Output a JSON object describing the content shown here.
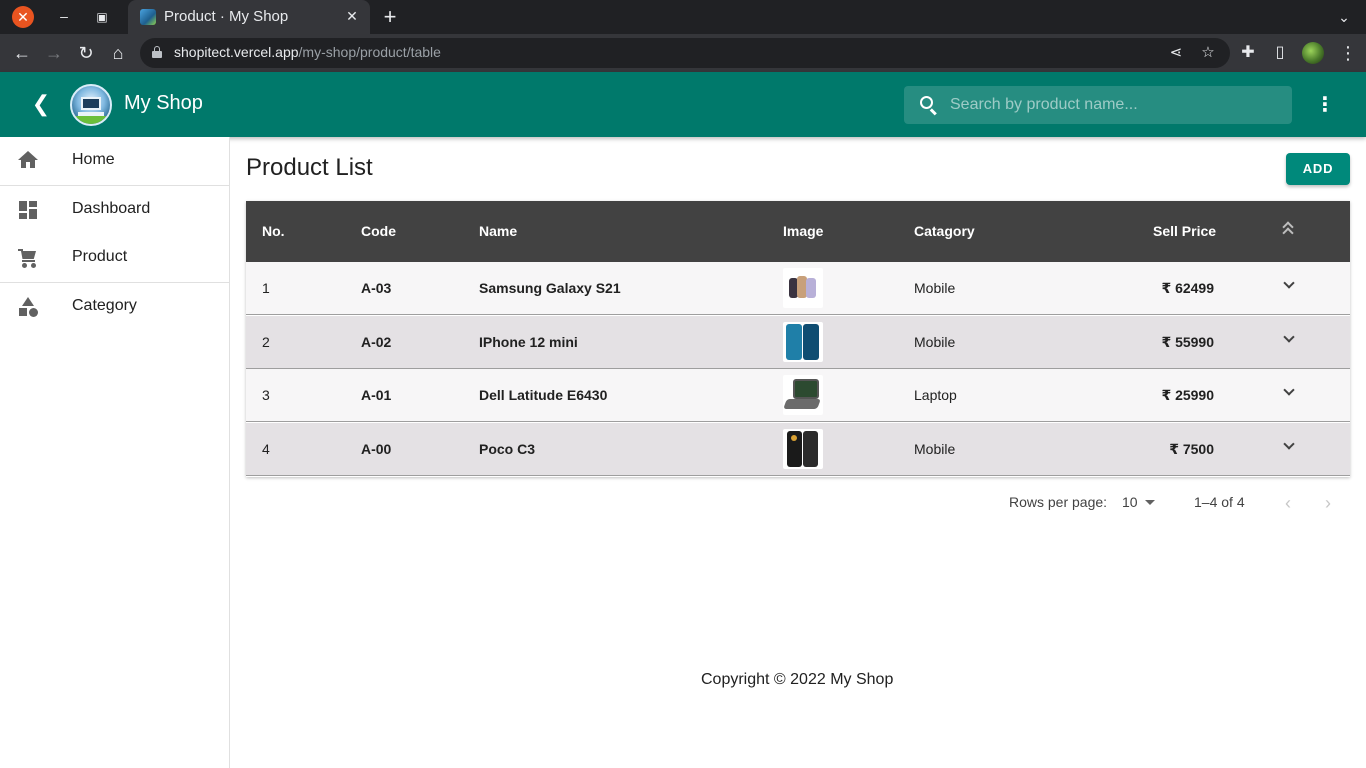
{
  "browser": {
    "tab_title": "Product · My Shop",
    "url_host": "shopitect.vercel.app",
    "url_path": "/my-shop/product/table"
  },
  "appbar": {
    "title": "My Shop",
    "search_placeholder": "Search by product name..."
  },
  "sidebar": {
    "items": [
      {
        "label": "Home",
        "icon": "home-icon"
      },
      {
        "label": "Dashboard",
        "icon": "dashboard-icon"
      },
      {
        "label": "Product",
        "icon": "cart-icon"
      },
      {
        "label": "Category",
        "icon": "category-icon"
      }
    ]
  },
  "main": {
    "title": "Product List",
    "add_label": "ADD"
  },
  "table": {
    "columns": [
      "No.",
      "Code",
      "Name",
      "Image",
      "Catagory",
      "Sell Price"
    ],
    "rows": [
      {
        "no": "1",
        "code": "A-03",
        "name": "Samsung Galaxy S21",
        "category": "Mobile",
        "price": "₹ 62499"
      },
      {
        "no": "2",
        "code": "A-02",
        "name": "IPhone 12 mini",
        "category": "Mobile",
        "price": "₹ 55990"
      },
      {
        "no": "3",
        "code": "A-01",
        "name": "Dell Latitude E6430",
        "category": "Laptop",
        "price": "₹ 25990"
      },
      {
        "no": "4",
        "code": "A-00",
        "name": "Poco C3",
        "category": "Mobile",
        "price": "₹ 7500"
      }
    ]
  },
  "pagination": {
    "rows_label": "Rows per page:",
    "rows_value": "10",
    "range": "1–4 of 4"
  },
  "footer": {
    "text": "Copyright © 2022 My Shop"
  },
  "colors": {
    "appbar": "#00796b",
    "add_button": "#00897b",
    "table_header": "#424242"
  }
}
